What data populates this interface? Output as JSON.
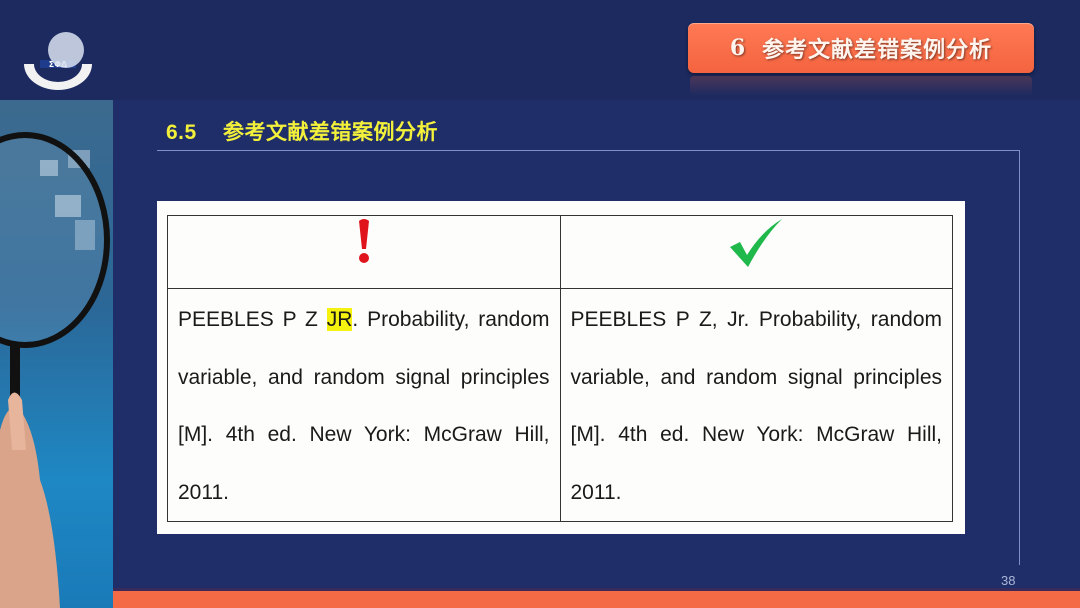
{
  "header": {
    "chapter_number": "6",
    "chapter_title": "参考文献差错案例分析",
    "accent_color": "#f4633f"
  },
  "section": {
    "number": "6.5",
    "title": "参考文献差错案例分析",
    "title_color": "#f2f03a"
  },
  "comparison": {
    "wrong": {
      "icon": "exclamation-icon",
      "icon_color": "#e0141b",
      "text_before": "PEEBLES   P   Z   ",
      "highlight": "JR",
      "text_after": ".  Probability, random variable, and random signal principles [M]. 4th ed. New York: McGraw Hill, 2011.",
      "highlight_color": "#f6f210"
    },
    "correct": {
      "icon": "checkmark-icon",
      "icon_color": "#1fb84a",
      "text": "PEEBLES P Z, Jr. Probability, random variable, and random signal principles [M]. 4th ed. New York: McGraw Hill, 2011."
    }
  },
  "footer": {
    "page_number": "38"
  }
}
